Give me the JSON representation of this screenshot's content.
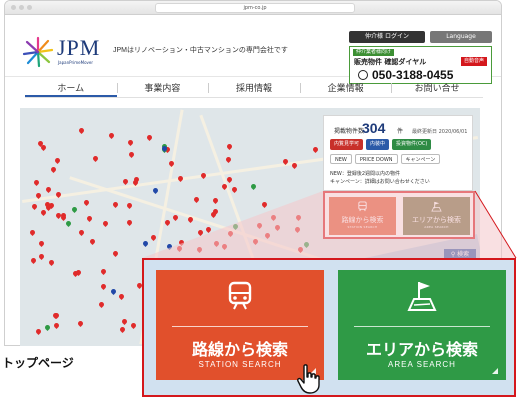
{
  "browser": {
    "url": "jpm-co.jp"
  },
  "header": {
    "logo_text": "JPM",
    "logo_sub": "JapanPrimeMover",
    "tagline": "JPMはリノベーション・中古マンションの専門会社です",
    "login_label": "仲介様 ログイン",
    "language_label": "Language",
    "agent": {
      "tag": "仲介業者様向け",
      "line": "販売物件 確認ダイヤル",
      "badge": "自動音声",
      "tel": "050-3188-0455"
    }
  },
  "nav": {
    "items": [
      {
        "label": "ホーム"
      },
      {
        "label": "事業内容"
      },
      {
        "label": "採用情報"
      },
      {
        "label": "企業情報"
      },
      {
        "label": "お問い合せ"
      }
    ]
  },
  "panel": {
    "count_label": "掲載物件数",
    "count": "304",
    "count_unit": "件",
    "date": "最終更新日 2020/06/01",
    "chips": [
      {
        "label": "内覧見学可",
        "color": "#c8302a"
      },
      {
        "label": "内装中",
        "color": "#2b5aa8"
      },
      {
        "label": "投資物件(OC)",
        "color": "#2e8b44"
      }
    ],
    "sorts": [
      "NEW",
      "PRICE DOWN",
      "キャンペーン"
    ],
    "note1": "NEW：登録後2週間以内の物件",
    "note2": "キャンペーン：詳細はお問い合わせください"
  },
  "search": {
    "station_title": "路線から検索",
    "station_sub": "STATION SEARCH",
    "area_title": "エリアから検索",
    "area_sub": "AREA SEARCH",
    "small_btn": "検索"
  },
  "caption": "トップページ",
  "colors": {
    "station": "#e1502c",
    "area": "#2f9a46",
    "highlight": "#d4171c",
    "brand": "#1e3b7a"
  }
}
